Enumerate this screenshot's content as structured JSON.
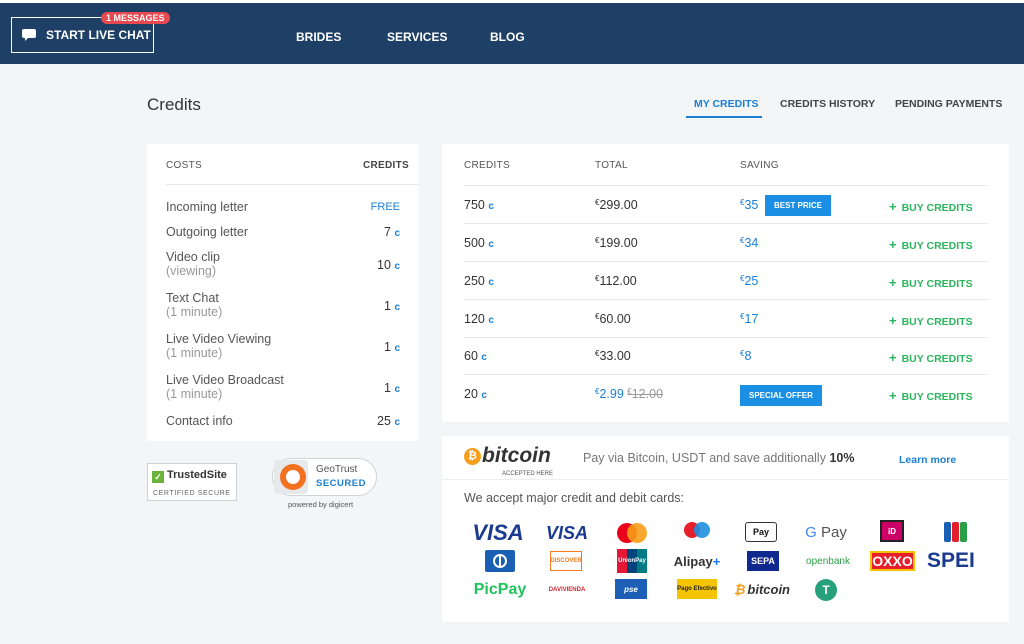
{
  "header": {
    "chat_label": "START LIVE CHAT",
    "messages_badge": "1 MESSAGES",
    "nav": [
      "BRIDES",
      "SERVICES",
      "BLOG"
    ]
  },
  "page": {
    "title": "Credits",
    "tabs": [
      "MY CREDITS",
      "CREDITS HISTORY",
      "PENDING PAYMENTS"
    ],
    "active_tab": "MY CREDITS"
  },
  "costs": {
    "col_costs": "COSTS",
    "col_credits": "CREDITS",
    "credit_symbol": "c",
    "rows": [
      {
        "label": "Incoming letter",
        "sub": "",
        "value": "FREE"
      },
      {
        "label": "Outgoing letter",
        "sub": "",
        "value": "7"
      },
      {
        "label": "Video clip",
        "sub": "(viewing)",
        "value": "10"
      },
      {
        "label": "Text Chat",
        "sub": "(1 minute)",
        "value": "1"
      },
      {
        "label": "Live Video Viewing",
        "sub": "(1 minute)",
        "value": "1"
      },
      {
        "label": "Live Video Broadcast",
        "sub": "(1 minute)",
        "value": "1"
      },
      {
        "label": "Contact info",
        "sub": "",
        "value": "25"
      }
    ]
  },
  "packages": {
    "col_credits": "CREDITS",
    "col_total": "TOTAL",
    "col_saving": "SAVING",
    "buy_label": "BUY CREDITS",
    "currency": "€",
    "rows": [
      {
        "credits": "750",
        "total": "299.00",
        "saving": "35",
        "tag": "BEST PRICE"
      },
      {
        "credits": "500",
        "total": "199.00",
        "saving": "34",
        "tag": ""
      },
      {
        "credits": "250",
        "total": "112.00",
        "saving": "25",
        "tag": ""
      },
      {
        "credits": "120",
        "total": "60.00",
        "saving": "17",
        "tag": ""
      },
      {
        "credits": "60",
        "total": "33.00",
        "saving": "8",
        "tag": ""
      },
      {
        "credits": "20",
        "total": "2.99",
        "old_total": "12.00",
        "saving": "",
        "tag": "SPECIAL OFFER"
      }
    ]
  },
  "payments": {
    "bitcoin_word": "bitcoin",
    "bitcoin_sub": "ACCEPTED HERE",
    "note_prefix": "Pay via Bitcoin, USDT and save additionally",
    "note_pct": "10%",
    "learn_more": "Learn more",
    "accept_text": "We accept major credit and debit cards:",
    "methods": [
      "VISA",
      "VISA Electron",
      "Mastercard",
      "Maestro",
      "Apple Pay",
      "G Pay",
      "iDEAL",
      "JCB",
      "Diners Club",
      "DISCOVER",
      "UnionPay",
      "Alipay+",
      "SEPA",
      "openbank",
      "OXXO",
      "SPEI",
      "PicPay",
      "DAVIVIENDA",
      "pse",
      "Pago Efectivo",
      "bitcoin",
      "Tether"
    ]
  },
  "trust": {
    "trustedsite": "TrustedSite",
    "trustedsite_sub": "CERTIFIED SECURE",
    "geotrust": "GeoTrust",
    "geotrust_sub": "SECURED",
    "digicert": "powered by digicert"
  },
  "colors": {
    "header_bg": "#1e3f66",
    "accent_blue": "#1a7fd4",
    "buy_green": "#2bb55d",
    "badge_red": "#e6494f",
    "bitcoin_orange": "#f59e1c"
  }
}
